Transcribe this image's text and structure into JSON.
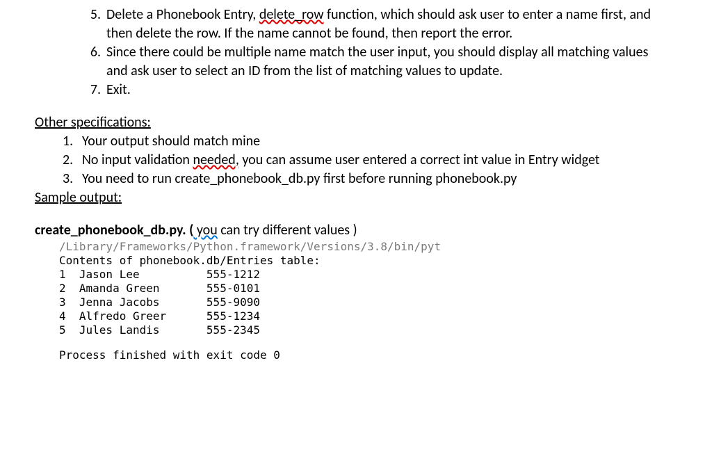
{
  "list_main": {
    "items": [
      {
        "n": "5.",
        "pre": "Delete a Phonebook Entry, ",
        "err": "delete_row",
        "post": " function, which should ask user to enter a name first, and then delete the row. If the name cannot be found, then report the error."
      },
      {
        "n": "6.",
        "text": "Since there could be multiple name match the user input, you should display all matching values and ask user to select an ID from the list of matching values to update."
      },
      {
        "n": "7.",
        "text": "Exit."
      }
    ]
  },
  "other_spec_heading": "Other specifications:",
  "spec_items": [
    {
      "n": "1.",
      "text": "Your output should match mine"
    },
    {
      "n": "2.",
      "pre": "No input validation ",
      "err": "needed,",
      "post": " you can assume user entered a correct int value in Entry widget"
    },
    {
      "n": "3.",
      "text": "You need to run create_phonebook_db.py first before running phonebook.py"
    }
  ],
  "sample_heading": "Sample output:",
  "create_line_pre": "create_phonebook_db.py.   (",
  "create_line_err": " you",
  "create_line_post": " can try different values )",
  "code": {
    "path": "/Library/Frameworks/Python.framework/Versions/3.8/bin/pyt",
    "contents": "Contents of phonebook.db/Entries table:",
    "rows": [
      "1  Jason Lee          555-1212",
      "2  Amanda Green       555-0101",
      "3  Jenna Jacobs       555-9090",
      "4  Alfredo Greer      555-1234",
      "5  Jules Landis       555-2345"
    ],
    "exit": "Process finished with exit code 0"
  }
}
